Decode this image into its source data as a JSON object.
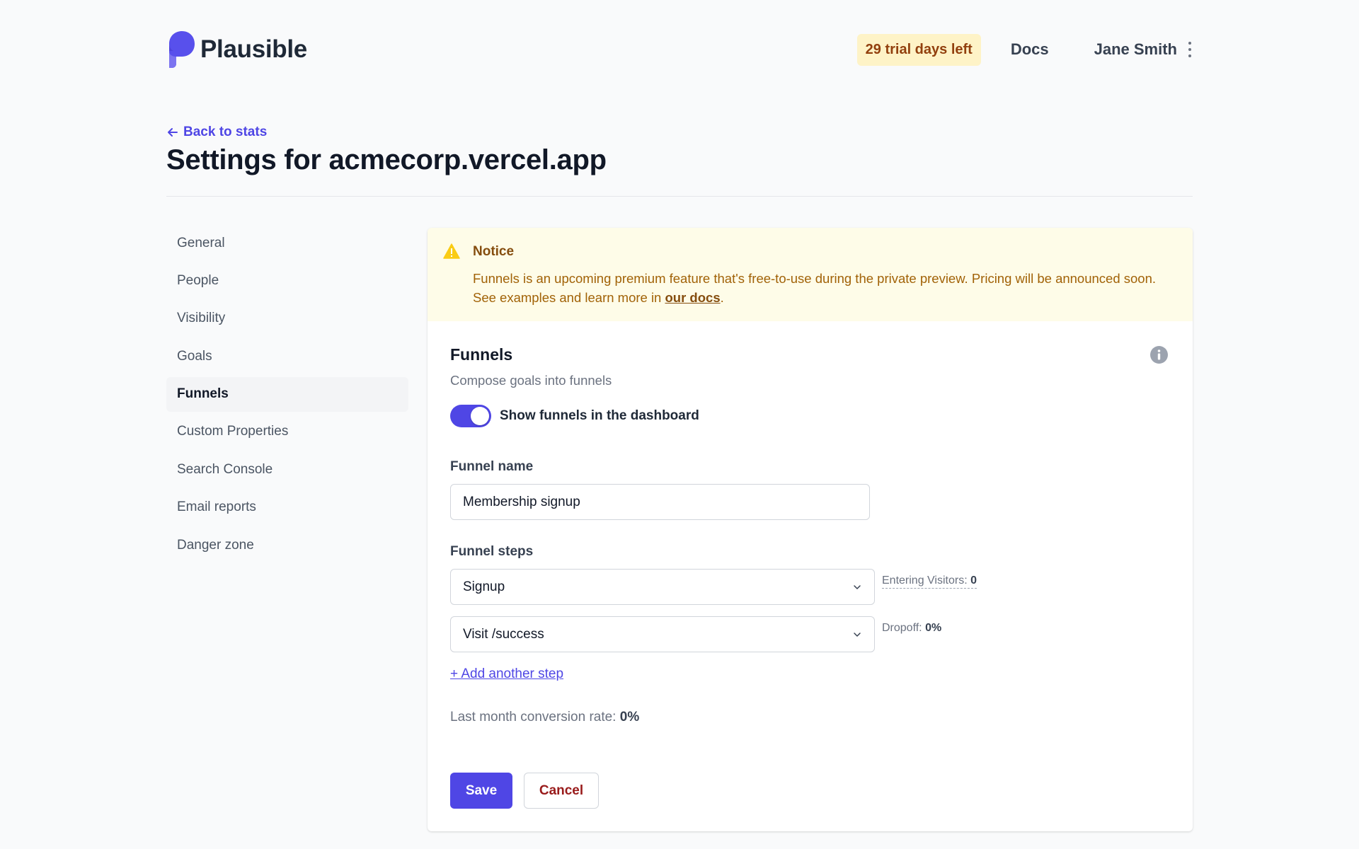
{
  "header": {
    "brand": "Plausible",
    "trial_badge": "29 trial days left",
    "docs_label": "Docs",
    "user_name": "Jane Smith"
  },
  "page": {
    "back_label": "Back to stats",
    "title": "Settings for acmecorp.vercel.app"
  },
  "sidebar": {
    "items": [
      {
        "label": "General"
      },
      {
        "label": "People"
      },
      {
        "label": "Visibility"
      },
      {
        "label": "Goals"
      },
      {
        "label": "Funnels",
        "active": true
      },
      {
        "label": "Custom Properties"
      },
      {
        "label": "Search Console"
      },
      {
        "label": "Email reports"
      },
      {
        "label": "Danger zone"
      }
    ]
  },
  "notice": {
    "title": "Notice",
    "body": "Funnels is an upcoming premium feature that's free-to-use during the private preview. Pricing will be announced soon. See examples and learn more in ",
    "link_text": "our docs",
    "suffix": "."
  },
  "funnels": {
    "title": "Funnels",
    "subtitle": "Compose goals into funnels",
    "toggle_label": "Show funnels in the dashboard",
    "toggle_on": true,
    "name_label": "Funnel name",
    "name_value": "Membership signup",
    "steps_label": "Funnel steps",
    "steps": [
      {
        "value": "Signup",
        "meta_label": "Entering Visitors: ",
        "meta_value": "0"
      },
      {
        "value": "Visit /success",
        "meta_label": "Dropoff: ",
        "meta_value": "0%"
      }
    ],
    "add_step_label": "+ Add another step",
    "conversion_label": "Last month conversion rate: ",
    "conversion_value": "0%",
    "save_label": "Save",
    "cancel_label": "Cancel"
  },
  "colors": {
    "accent": "#4f46e5",
    "notice_bg": "#fefce8",
    "trial_bg": "#fef3c7",
    "danger": "#991b1b"
  },
  "icons": {
    "logo": "plausible-logo-icon",
    "back": "arrow-left-icon",
    "notice": "warning-triangle-icon",
    "info": "info-circle-icon",
    "select": "chevron-down-icon",
    "menu": "kebab-menu-icon"
  }
}
